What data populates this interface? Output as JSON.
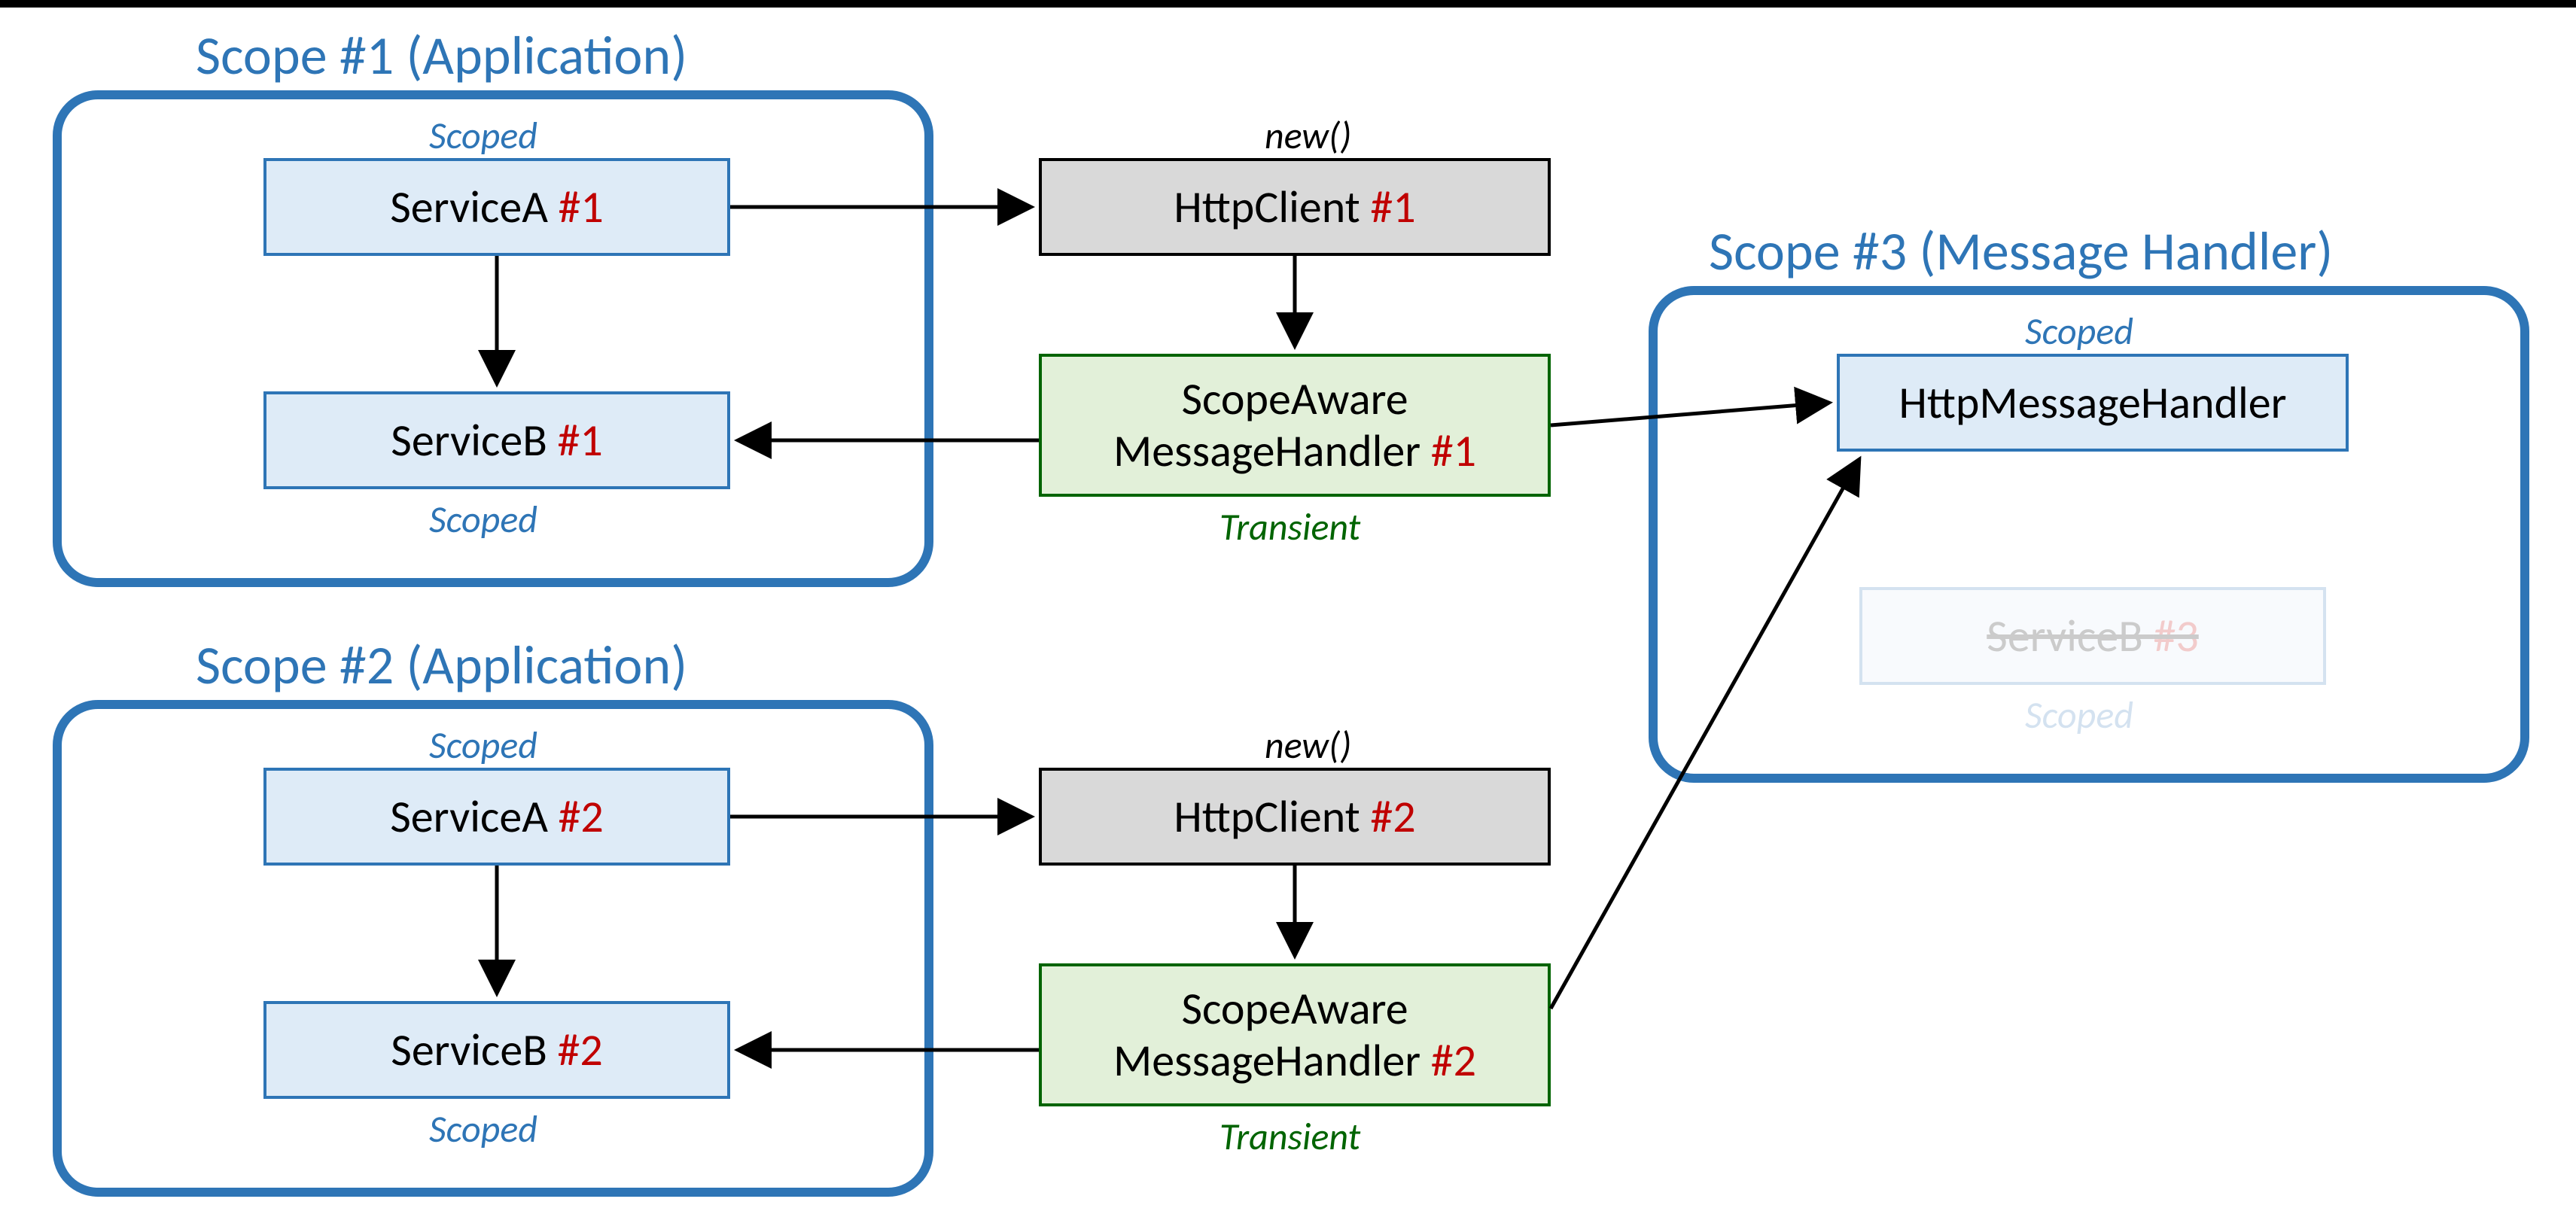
{
  "scopes": {
    "s1": {
      "title": "Scope #1 (Application)"
    },
    "s2": {
      "title": "Scope #2 (Application)"
    },
    "s3": {
      "title": "Scope #3 (Message Handler)"
    }
  },
  "lifetimes": {
    "scoped": "Scoped",
    "transient": "Transient",
    "newcall": "new()"
  },
  "nodes": {
    "serviceA1": {
      "name": "ServiceA ",
      "inst": "#1"
    },
    "serviceB1": {
      "name": "ServiceB ",
      "inst": "#1"
    },
    "httpClient1": {
      "name": "HttpClient ",
      "inst": "#1"
    },
    "sah1_l1": "ScopeAware",
    "sah1_l2": {
      "name": "MessageHandler ",
      "inst": "#1"
    },
    "serviceA2": {
      "name": "ServiceA ",
      "inst": "#2"
    },
    "serviceB2": {
      "name": "ServiceB ",
      "inst": "#2"
    },
    "httpClient2": {
      "name": "HttpClient ",
      "inst": "#2"
    },
    "sah2_l1": "ScopeAware",
    "sah2_l2": {
      "name": "MessageHandler ",
      "inst": "#2"
    },
    "httpMsgHandler": "HttpMessageHandler",
    "serviceB3": {
      "name": "ServiceB ",
      "inst": "#3"
    }
  }
}
